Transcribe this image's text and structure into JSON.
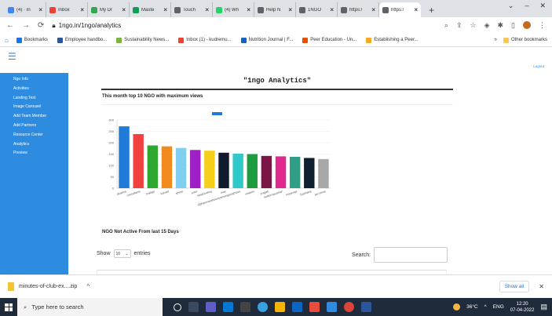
{
  "browser": {
    "tabs": [
      {
        "title": "(4) · In",
        "color": "#4285f4"
      },
      {
        "title": "Inbox",
        "color": "#ea4335"
      },
      {
        "title": "My Dr",
        "color": "#34a853"
      },
      {
        "title": "Maste",
        "color": "#0f9d58"
      },
      {
        "title": "Touch",
        "color": "#5f6368"
      },
      {
        "title": "(4) Wh",
        "color": "#25d366"
      },
      {
        "title": "Help N",
        "color": "#5f6368"
      },
      {
        "title": "1NGO",
        "color": "#5f6368"
      },
      {
        "title": "https:/",
        "color": "#5f6368"
      },
      {
        "title": "https:/",
        "color": "#5f6368",
        "active": true
      }
    ],
    "url": "1ngo.in/1ngo/analytics",
    "bookmarks": [
      {
        "label": "Bookmarks",
        "color": "#1a73e8"
      },
      {
        "label": "Employee handbo...",
        "color": "#2b579a"
      },
      {
        "label": "Sustainability News...",
        "color": "#7cb342"
      },
      {
        "label": "Inbox (1) - kudremu...",
        "color": "#ea4335"
      },
      {
        "label": "Nutrition Journal | F...",
        "color": "#1565c0"
      },
      {
        "label": "Peer Education - Un...",
        "color": "#e65100"
      },
      {
        "label": "Establishing a Peer...",
        "color": "#f9a825"
      }
    ],
    "bookmarks_more": "»",
    "other_bookmarks": "Other bookmarks"
  },
  "app": {
    "logout": "Logout",
    "sidebar": [
      "Ngo Info",
      "Activities",
      "Landing Text",
      "Image Carousel",
      "Add Team Member",
      "Add Partners",
      "Resource Center",
      "Analytics",
      "Preview"
    ],
    "page_title": "\"1ngo Analytics\"",
    "chart_heading": "This month top 10 NGO with maximum views",
    "inactive_heading": "NGO Not Active From last 15 Days",
    "table_controls": {
      "show_label": "Show",
      "entries_value": "10",
      "entries_label": "entries",
      "search_label": "Search:"
    }
  },
  "chart_data": {
    "type": "bar",
    "categories": [
      "akadina",
      "consultants",
      "madiga",
      "kalvasi",
      "sthree",
      "educ",
      "kbaktivating",
      "mas",
      "alpharimasehistorysmarajamathasa",
      "vnawes",
      "pragati",
      "kaliforniasarkari",
      "mayenga",
      "Sashakta",
      "jan-sewa"
    ],
    "values": [
      272,
      238,
      188,
      184,
      177,
      168,
      165,
      156,
      152,
      150,
      142,
      140,
      138,
      133,
      128
    ],
    "colors": [
      "#1f7ad8",
      "#f04040",
      "#2ea82e",
      "#f28b1d",
      "#7fd0f0",
      "#a020c8",
      "#f5cf1a",
      "#101c2c",
      "#30c8c8",
      "#1d9e3e",
      "#7c1447",
      "#e0288f",
      "#2e9e86",
      "#10202e",
      "#a8a8a8"
    ],
    "yticks": [
      0,
      50,
      100,
      150,
      200,
      250,
      300
    ],
    "ylim": [
      0,
      300
    ],
    "legend_color": "#1f7ad8"
  },
  "downloads": {
    "file": "minutes-of-club-ex....zip",
    "show_all": "Show all"
  },
  "taskbar": {
    "search_placeholder": "Type here to search",
    "temperature": "36°C",
    "language": "ENG",
    "time": "12:20",
    "date": "07-04-2022"
  }
}
